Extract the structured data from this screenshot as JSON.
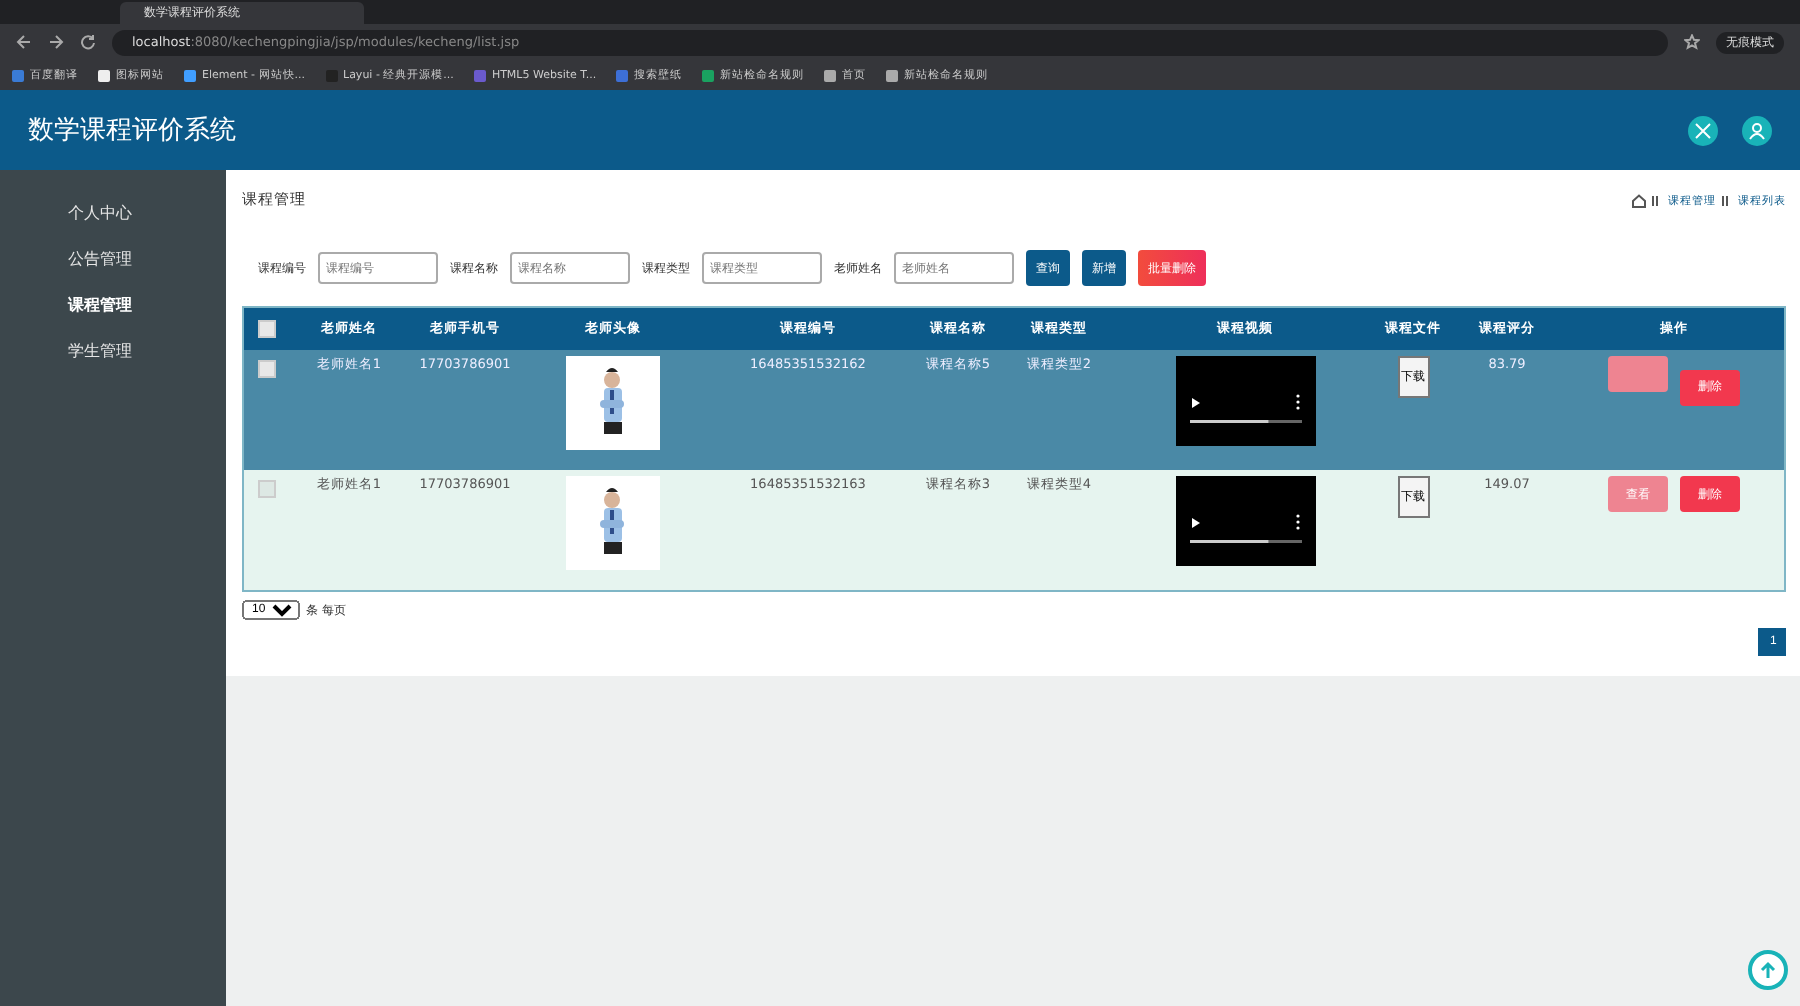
{
  "browser": {
    "tab_title": "数学课程评价系统",
    "url_host": "localhost",
    "url_rest": ":8080/kechengpingjia/jsp/modules/kecheng/list.jsp",
    "profile": "无痕模式",
    "bookmarks": [
      "百度翻译",
      "图标网站",
      "Element - 网站快...",
      "Layui - 经典开源模...",
      "HTML5 Website T...",
      "搜索壁纸",
      "新站检命名规则",
      "首页",
      "新站检命名规则"
    ]
  },
  "app": {
    "title": "数学课程评价系统"
  },
  "sidebar": {
    "items": [
      {
        "label": "个人中心",
        "selected": false
      },
      {
        "label": "公告管理",
        "selected": false
      },
      {
        "label": "课程管理",
        "selected": true
      },
      {
        "label": "学生管理",
        "selected": false
      }
    ]
  },
  "page": {
    "title": "课程管理",
    "breadcrumb": [
      "课程管理",
      "课程列表"
    ]
  },
  "search": {
    "fields": [
      {
        "label": "课程编号",
        "placeholder": "课程编号"
      },
      {
        "label": "课程名称",
        "placeholder": "课程名称"
      },
      {
        "label": "课程类型",
        "placeholder": "课程类型"
      },
      {
        "label": "老师姓名",
        "placeholder": "老师姓名"
      }
    ],
    "buttons": [
      {
        "label": "查询",
        "kind": "primary"
      },
      {
        "label": "新增",
        "kind": "primary"
      },
      {
        "label": "批量删除",
        "kind": "danger"
      }
    ]
  },
  "table": {
    "all_checked": false,
    "columns": [
      "老师姓名",
      "老师手机号",
      "老师头像",
      "课程编号",
      "课程名称",
      "课程类型",
      "课程视频",
      "课程文件",
      "课程评分",
      "操作"
    ],
    "rows": [
      {
        "selected": true,
        "checked": false,
        "teacher": "老师姓名1",
        "phone": "17703786901",
        "code": "16485351532162",
        "name": "课程名称5",
        "type": "课程类型2",
        "video": {
          "level": 0.7
        },
        "file_button": "下载",
        "score": "83.79",
        "actions": [
          {
            "kind": "view"
          },
          {
            "kind": "delete",
            "label": "删除"
          }
        ]
      },
      {
        "selected": false,
        "checked": false,
        "teacher": "老师姓名1",
        "phone": "17703786901",
        "code": "16485351532163",
        "name": "课程名称3",
        "type": "课程类型4",
        "video": {
          "level": 0.7
        },
        "file_button": "下载",
        "score": "149.07",
        "actions": [
          {
            "kind": "view",
            "label": "查看"
          },
          {
            "kind": "delete",
            "label": "删除"
          }
        ]
      }
    ]
  },
  "pager": {
    "page_size": "10",
    "per_page_label": "条 每页",
    "pages": [
      {
        "label": "1",
        "selected": true
      }
    ]
  }
}
